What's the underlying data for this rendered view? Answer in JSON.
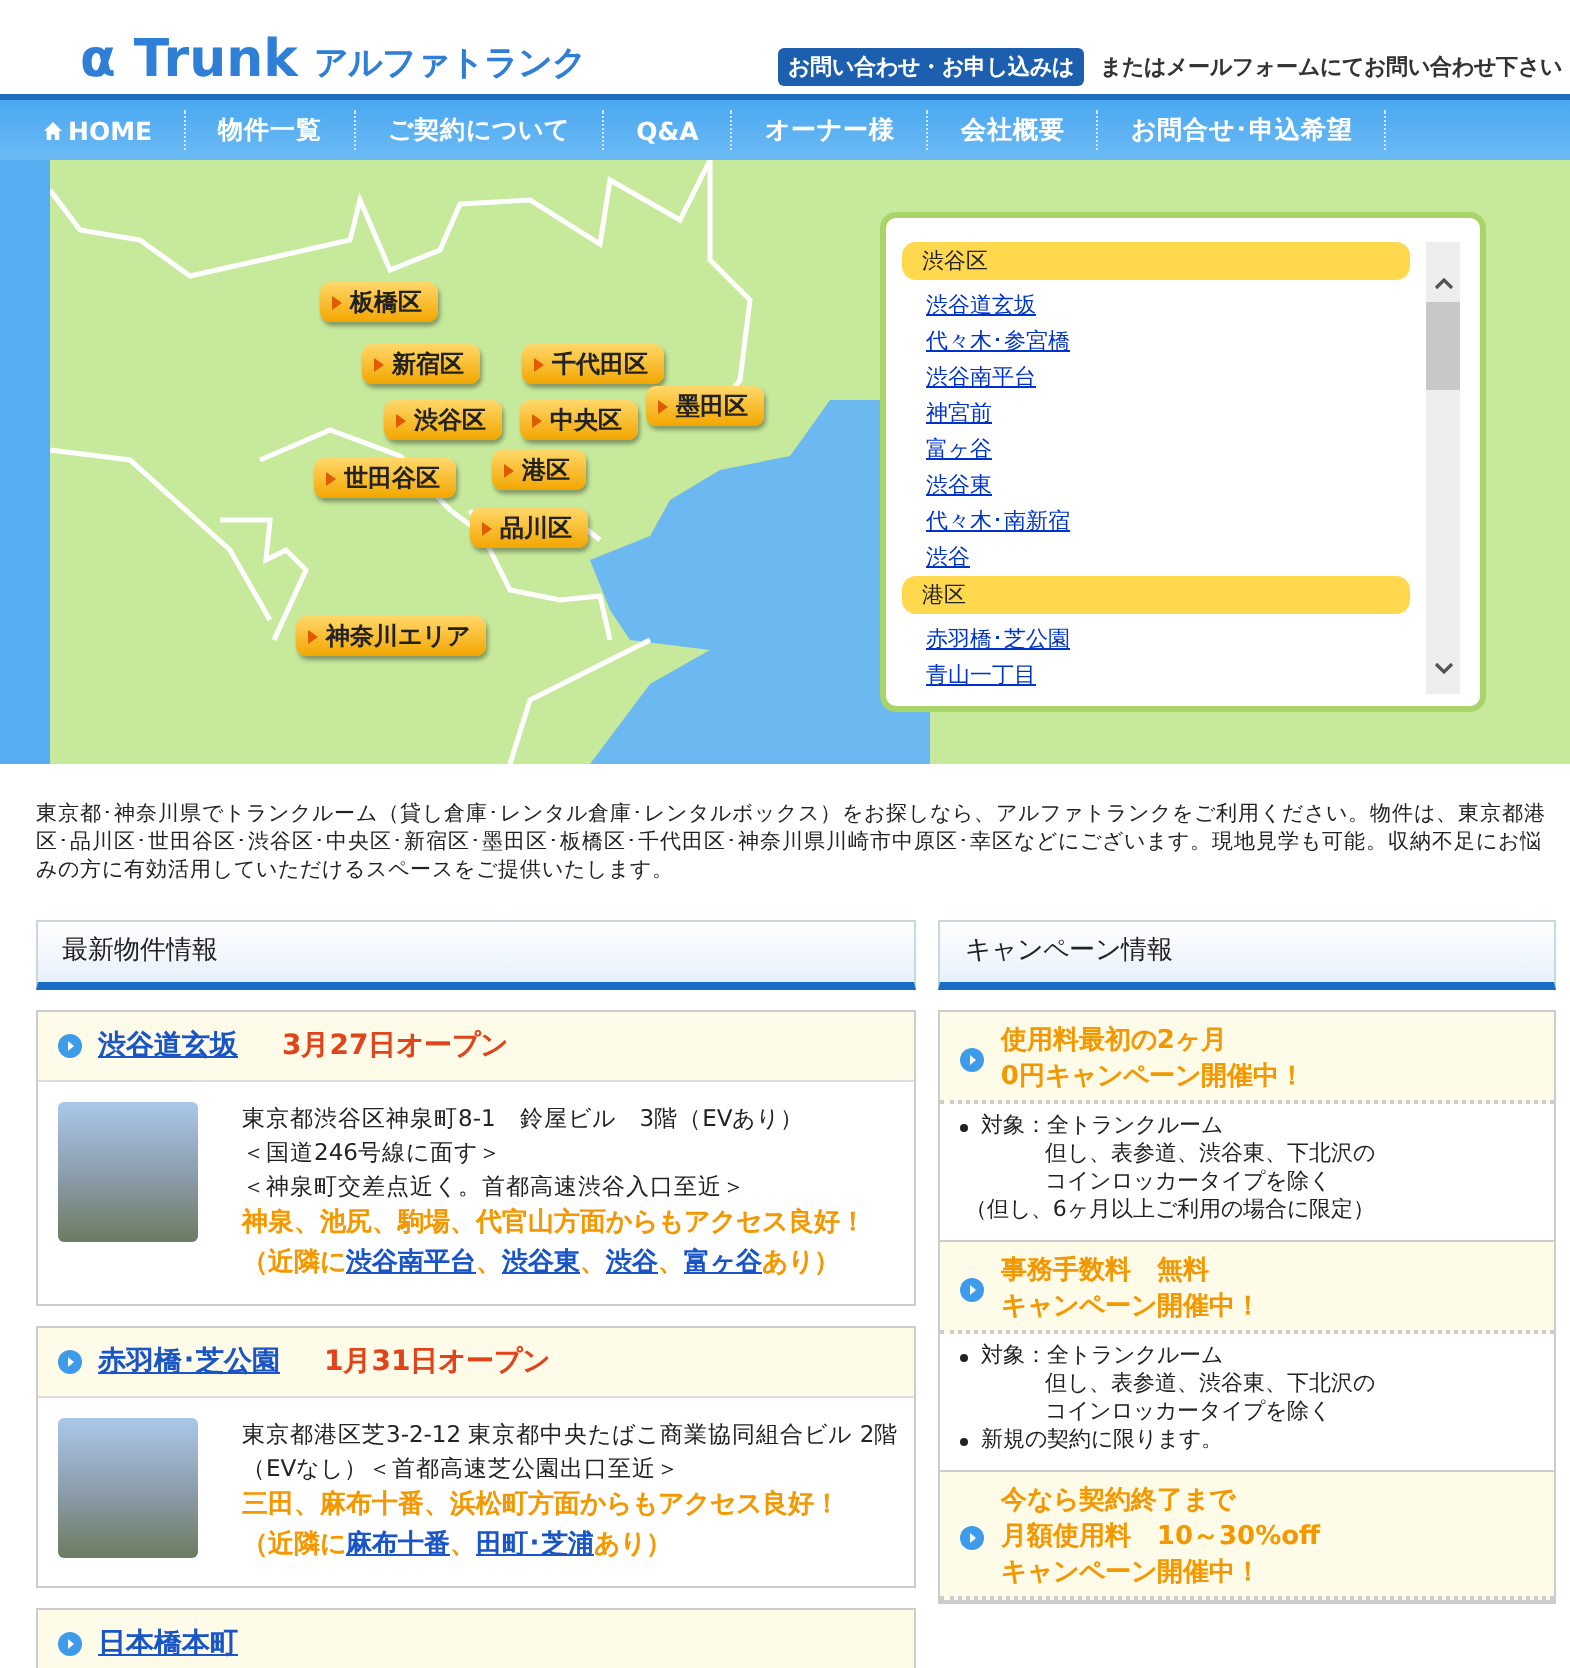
{
  "header": {
    "logo": "α Trunk",
    "logo_kana": "アルファトランク",
    "contact_badge": "お問い合わせ・お申し込みは",
    "contact_note": "またはメールフォームにてお問い合わせ下さい"
  },
  "nav": [
    {
      "label": "HOME",
      "kind": "home"
    },
    {
      "label": "物件一覧",
      "kind": "text"
    },
    {
      "label": "ご契約について",
      "kind": "text"
    },
    {
      "label": "Q&A",
      "kind": "text"
    },
    {
      "label": "オーナー様",
      "kind": "text"
    },
    {
      "label": "会社概要",
      "kind": "text"
    },
    {
      "label": "お問合せ･申込希望",
      "kind": "text"
    }
  ],
  "map": {
    "areas": [
      "板橋区",
      "新宿区",
      "千代田区",
      "渋谷区",
      "中央区",
      "墨田区",
      "世田谷区",
      "港区",
      "品川区",
      "神奈川エリア"
    ]
  },
  "area_list": [
    {
      "heading": "渋谷区",
      "links": [
        "渋谷道玄坂",
        "代々木･参宮橋",
        "渋谷南平台",
        "神宮前",
        "富ヶ谷",
        "渋谷東",
        "代々木･南新宿",
        "渋谷"
      ]
    },
    {
      "heading": "港区",
      "links": [
        "赤羽橋･芝公園",
        "青山一丁目"
      ]
    }
  ],
  "intro": "東京都･神奈川県でトランクルーム（貸し倉庫･レンタル倉庫･レンタルボックス）をお探しなら、アルファトランクをご利用ください。物件は、東京都港区･品川区･世田谷区･渋谷区･中央区･新宿区･墨田区･板橋区･千代田区･神奈川県川崎市中原区･幸区などにございます。現地見学も可能。収納不足にお悩みの方に有効活用していただけるスペースをご提供いたします。",
  "new_listings": {
    "title": "最新物件情報",
    "items": [
      {
        "name": "渋谷道玄坂",
        "date": "3月27日オープン",
        "address": [
          "東京都渋谷区神泉町8-1　鈴屋ビル　3階（EVあり）",
          "＜国道246号線に面す＞",
          "＜神泉町交差点近く。首都高速渋谷入口至近＞"
        ],
        "access": "神泉、池尻、駒場、代官山方面からもアクセス良好！",
        "nearby": {
          "prefix": "（近隣に",
          "separator": "、",
          "links": [
            "渋谷南平台",
            "渋谷東",
            "渋谷",
            "富ヶ谷"
          ],
          "suffix": "あり）"
        }
      },
      {
        "name": "赤羽橋･芝公園",
        "date": "1月31日オープン",
        "address": [
          "東京都港区芝3-2-12 東京都中央たばこ商業協同組合ビル 2階（EVなし）＜首都高速芝公園出口至近＞"
        ],
        "access": "三田、麻布十番、浜松町方面からもアクセス良好！",
        "nearby": {
          "prefix": "（近隣に",
          "separator": "、",
          "links": [
            "麻布十番",
            "田町･芝浦"
          ],
          "suffix": "あり）"
        }
      },
      {
        "name": "日本橋本町"
      }
    ]
  },
  "campaigns": {
    "title": "キャンペーン情報",
    "items": [
      {
        "title": [
          "使用料最初の2ヶ月",
          "0円キャンペーン開催中！"
        ],
        "body": [
          {
            "kind": "bullet",
            "lines": [
              "対象：全トランクルーム",
              "但し、表参道、渋谷東、下北沢の",
              "コインロッカータイプを除く"
            ]
          },
          {
            "kind": "note",
            "lines": [
              "（但し、6ヶ月以上ご利用の場合に限定）"
            ]
          }
        ]
      },
      {
        "title": [
          "事務手数料　無料",
          "キャンペーン開催中！"
        ],
        "body": [
          {
            "kind": "bullet",
            "lines": [
              "対象：全トランクルーム",
              "但し、表参道、渋谷東、下北沢の",
              "コインロッカータイプを除く"
            ]
          },
          {
            "kind": "bullet",
            "lines": [
              "新規の契約に限ります。"
            ]
          }
        ]
      },
      {
        "title": [
          "今なら契約終了まで",
          "月額使用料　10～30%off",
          "キャンペーン開催中！"
        ]
      }
    ]
  }
}
